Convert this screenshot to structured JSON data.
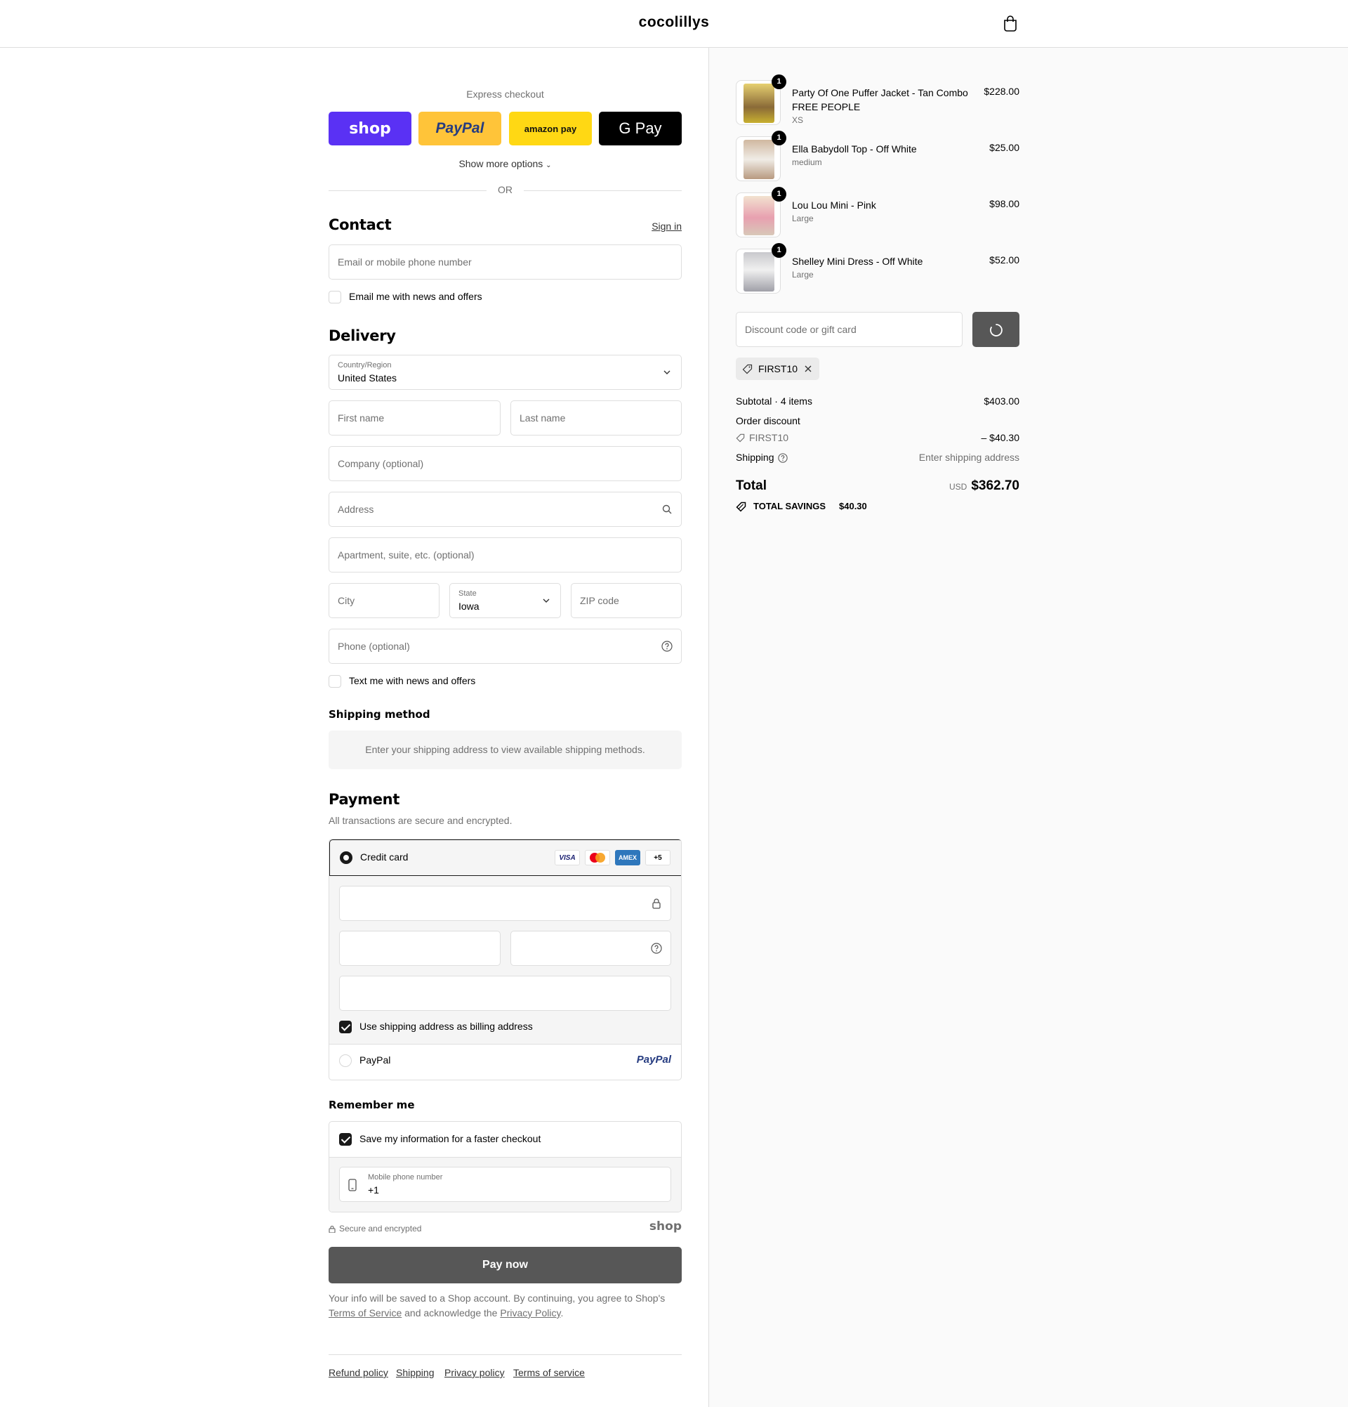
{
  "header": {
    "store_name": "cocolillys",
    "cart_icon": "shopping-bag-icon"
  },
  "express": {
    "title": "Express checkout",
    "buttons": [
      {
        "name": "shop",
        "label": "shop",
        "bg": "#5a31f4"
      },
      {
        "name": "paypal",
        "label": "PayPal",
        "bg": "#ffc439"
      },
      {
        "name": "amazonpay",
        "label": "amazon pay",
        "bg": "#ffd814"
      },
      {
        "name": "gpay",
        "label": "G Pay",
        "bg": "#000000"
      }
    ],
    "more_options": "Show more options",
    "or": "OR"
  },
  "contact": {
    "title": "Contact",
    "sign_in": "Sign in",
    "email_placeholder": "Email or mobile phone number",
    "news_label": "Email me with news and offers"
  },
  "delivery": {
    "title": "Delivery",
    "country_label": "Country/Region",
    "country_value": "United States",
    "first_name": "First name",
    "last_name": "Last name",
    "company": "Company (optional)",
    "address": "Address",
    "apartment": "Apartment, suite, etc. (optional)",
    "city": "City",
    "state_label": "State",
    "state_value": "Iowa",
    "zip": "ZIP code",
    "phone": "Phone (optional)",
    "text_label": "Text me with news and offers"
  },
  "shipping_method": {
    "title": "Shipping method",
    "message": "Enter your shipping address to view available shipping methods."
  },
  "payment": {
    "title": "Payment",
    "subtitle": "All transactions are secure and encrypted.",
    "credit_card_label": "Credit card",
    "card_logos": [
      "VISA",
      "MC",
      "AMEX",
      "+5"
    ],
    "billing_label": "Use shipping address as billing address",
    "paypal_label": "PayPal",
    "paypal_logo": "PayPal"
  },
  "remember": {
    "title": "Remember me",
    "save_label": "Save my information for a faster checkout",
    "mobile_label": "Mobile phone number",
    "mobile_value": "+1",
    "secure": "Secure and encrypted",
    "shop_logo": "shop"
  },
  "pay_now": "Pay now",
  "legal": {
    "text1": "Your info will be saved to a Shop account. By continuing, you agree to Shop's",
    "tos": "Terms of Service",
    "text2": "and acknowledge the",
    "privacy": "Privacy Policy",
    "end": "."
  },
  "footer_links": [
    "Refund policy",
    "Shipping",
    "Privacy policy",
    "Terms of service"
  ],
  "order": {
    "items": [
      {
        "name": "Party Of One Puffer Jacket - Tan Combo FREE PEOPLE",
        "variant": "XS",
        "price": "$228.00",
        "qty": "1",
        "color": "#c8b030"
      },
      {
        "name": "Ella Babydoll Top - Off White",
        "variant": "medium",
        "price": "$25.00",
        "qty": "1",
        "color": "#b89a80"
      },
      {
        "name": "Lou Lou Mini - Pink",
        "variant": "Large",
        "price": "$98.00",
        "qty": "1",
        "color": "#e8a0b0"
      },
      {
        "name": "Shelley Mini Dress - Off White",
        "variant": "Large",
        "price": "$52.00",
        "qty": "1",
        "color": "#a0a0a8"
      }
    ],
    "discount_placeholder": "Discount code or gift card",
    "applied_code": "FIRST10",
    "subtotal_label": "Subtotal · 4 items",
    "subtotal": "$403.00",
    "order_discount_label": "Order discount",
    "discount_code": "FIRST10",
    "discount_amount": "– $40.30",
    "shipping_label": "Shipping",
    "shipping_value": "Enter shipping address",
    "total_label": "Total",
    "currency": "USD",
    "total": "$362.70",
    "savings_label": "TOTAL SAVINGS",
    "savings": "$40.30"
  }
}
